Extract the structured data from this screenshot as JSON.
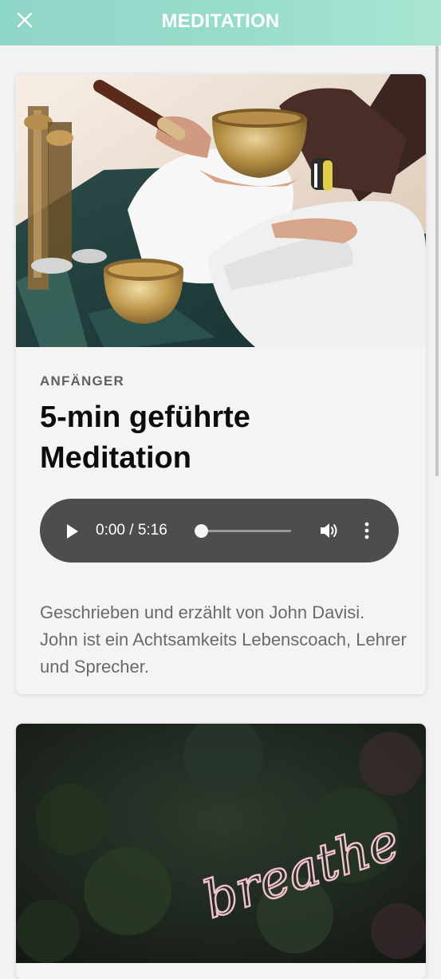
{
  "header": {
    "title": "MEDITATION",
    "close_icon": "close-icon",
    "gradient_colors": [
      "#8ed6c7",
      "#a9e6d3"
    ]
  },
  "cards": [
    {
      "image": "singing-bowl-meditation-photo",
      "level": "ANFÄNGER",
      "title": "5-min geführte Meditation",
      "player": {
        "time": "0:00 / 5:16",
        "progress": 0,
        "play_icon": "play-icon",
        "volume_icon": "volume-icon",
        "more_icon": "more-vertical-icon"
      },
      "description": "Geschrieben und erzählt von John Davisi. John ist ein Achtsamkeits Lebenscoach, Lehrer und Sprecher."
    },
    {
      "image": "breathe-neon-sign-photo",
      "image_text": "breathe"
    }
  ],
  "colors": {
    "background": "#f2f2f2",
    "card": "#f4f4f4",
    "player": "#4d4d4d",
    "title": "#0c0c0c",
    "muted": "#6a6a6a"
  }
}
